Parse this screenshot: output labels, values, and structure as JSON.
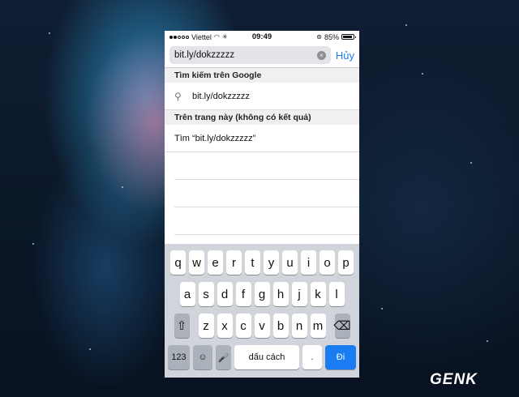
{
  "status_bar": {
    "carrier": "Viettel",
    "time": "09:49",
    "battery": "85%"
  },
  "address_bar": {
    "value": "bit.ly/dokzzzzz",
    "cancel_label": "Hủy"
  },
  "google_section": {
    "title": "Tìm kiếm trên Google",
    "suggestion": "bit.ly/dokzzzzz"
  },
  "page_section": {
    "title": "Trên trang này (không có kết quả)",
    "find_text": "Tìm “bit.ly/dokzzzzz”"
  },
  "keyboard": {
    "row1": [
      "q",
      "w",
      "e",
      "r",
      "t",
      "y",
      "u",
      "i",
      "o",
      "p"
    ],
    "row2": [
      "a",
      "s",
      "d",
      "f",
      "g",
      "h",
      "j",
      "k",
      "l"
    ],
    "row3": [
      "z",
      "x",
      "c",
      "v",
      "b",
      "n",
      "m"
    ],
    "numbers_label": "123",
    "space_label": "dấu cách",
    "period_label": ".",
    "go_label": "Đi"
  },
  "watermark": "GENK",
  "colors": {
    "accent": "#1a7cf2",
    "keyboard_bg": "#d1d5db"
  }
}
